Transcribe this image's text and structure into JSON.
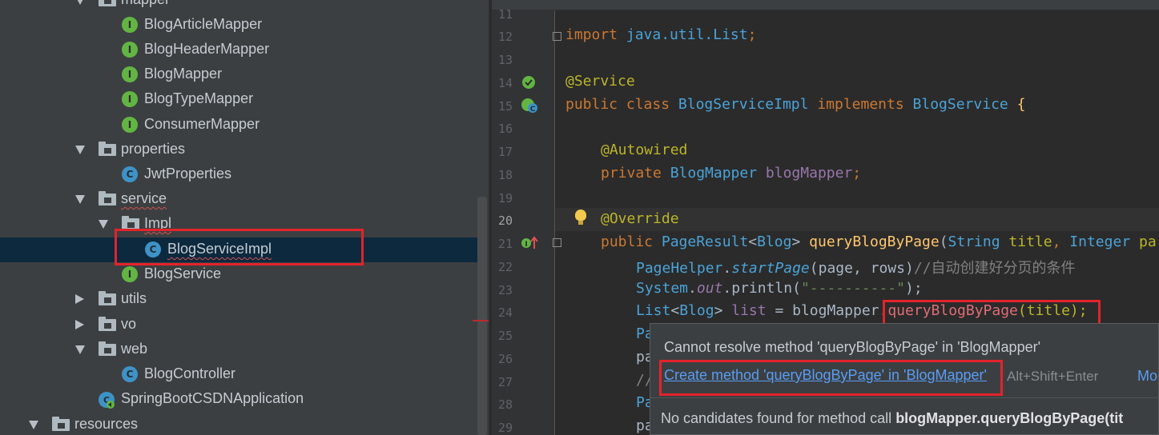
{
  "project_tree": {
    "items": [
      {
        "label": "mapper",
        "kind": "folder",
        "expanded": true
      },
      {
        "label": "BlogArticleMapper",
        "kind": "interface"
      },
      {
        "label": "BlogHeaderMapper",
        "kind": "interface"
      },
      {
        "label": "BlogMapper",
        "kind": "interface"
      },
      {
        "label": "BlogTypeMapper",
        "kind": "interface"
      },
      {
        "label": "ConsumerMapper",
        "kind": "interface"
      },
      {
        "label": "properties",
        "kind": "folder",
        "expanded": true
      },
      {
        "label": "JwtProperties",
        "kind": "class"
      },
      {
        "label": "service",
        "kind": "folder",
        "expanded": true
      },
      {
        "label": "Impl",
        "kind": "folder",
        "expanded": true
      },
      {
        "label": "BlogServiceImpl",
        "kind": "class",
        "selected": true
      },
      {
        "label": "BlogService",
        "kind": "interface"
      },
      {
        "label": "utils",
        "kind": "folder",
        "expanded": false
      },
      {
        "label": "vo",
        "kind": "folder",
        "expanded": false
      },
      {
        "label": "web",
        "kind": "folder",
        "expanded": true
      },
      {
        "label": "BlogController",
        "kind": "class"
      },
      {
        "label": "SpringBootCSDNApplication",
        "kind": "app"
      },
      {
        "label": "resources",
        "kind": "folder",
        "expanded": true
      }
    ],
    "icon_letters": {
      "interface": "I",
      "class": "C"
    }
  },
  "editor": {
    "current_line": "20",
    "lines": [
      {
        "n": "11"
      },
      {
        "n": "12",
        "text": "import java.util.List;"
      },
      {
        "n": "13"
      },
      {
        "n": "14",
        "text": "@Service"
      },
      {
        "n": "15",
        "text": "public class BlogServiceImpl implements BlogService {"
      },
      {
        "n": "16"
      },
      {
        "n": "17",
        "text": "@Autowired"
      },
      {
        "n": "18",
        "text": "private BlogMapper blogMapper;"
      },
      {
        "n": "19"
      },
      {
        "n": "20",
        "text": "@Override"
      },
      {
        "n": "21",
        "text": "public PageResult<Blog> queryBlogByPage(String title, Integer pa"
      },
      {
        "n": "22",
        "text": "PageHelper.startPage(page, rows);//自动创建好分页的条件"
      },
      {
        "n": "23",
        "text": "System.out.println(\"----------\");"
      },
      {
        "n": "24",
        "text": "List<Blog> list = blogMapper.queryBlogByPage(title);"
      },
      {
        "n": "25",
        "text": "Pa"
      },
      {
        "n": "26",
        "text": "pa"
      },
      {
        "n": "27",
        "text": "//"
      },
      {
        "n": "28",
        "text": "Pa"
      },
      {
        "n": "29",
        "text": "pa"
      }
    ]
  },
  "tokens": {
    "import_kw": "import",
    "import_path": " java.util.List",
    "semi": ";",
    "service_ann": "@Service",
    "public_kw": "public",
    "class_kw": "class",
    "class_name": "BlogServiceImpl",
    "implements_kw": "implements",
    "iface_name": "BlogService",
    "brace": " {",
    "autowired_ann": "@Autowired",
    "private_kw": "private",
    "mapper_type": "BlogMapper",
    "mapper_field": "blogMapper",
    "override_ann": "@Override",
    "ret_type": "PageResult",
    "generic_open": "<",
    "blog": "Blog",
    "generic_close": ">",
    "method_name": "queryBlogByPage",
    "paren_open": "(",
    "string_type": "String",
    "param_title": "title",
    "comma": ", ",
    "integer_type": "Integer",
    "param_pa": "pa",
    "pagehelper": "PageHelper",
    "dot": ".",
    "startpage": "startPage",
    "args_page": "(page, rows)",
    "comment_cn": "//自动创建好分页的条件",
    "system": "System",
    "out": "out",
    "println": "println",
    "dash_str": "\"----------\"",
    "close_paren_semi": ");",
    "list_type": "List",
    "list_var": "list",
    "equals": " = ",
    "call_method": "queryBlogByPage",
    "call_args": "(title);"
  },
  "popup": {
    "message": "Cannot resolve method 'queryBlogByPage' in 'BlogMapper'",
    "fix_link": "Create method 'queryBlogByPage' in 'BlogMapper'",
    "shortcut": "Alt+Shift+Enter",
    "more": "Mo",
    "footer_prefix": "No candidates found for method call ",
    "footer_bold": "blogMapper.queryBlogByPage(tit"
  },
  "colors": {
    "highlight_border": "#e3232c",
    "selection": "#0d293e",
    "interface_icon": "#62b543",
    "class_icon": "#3d93c7",
    "link": "#589df6"
  }
}
